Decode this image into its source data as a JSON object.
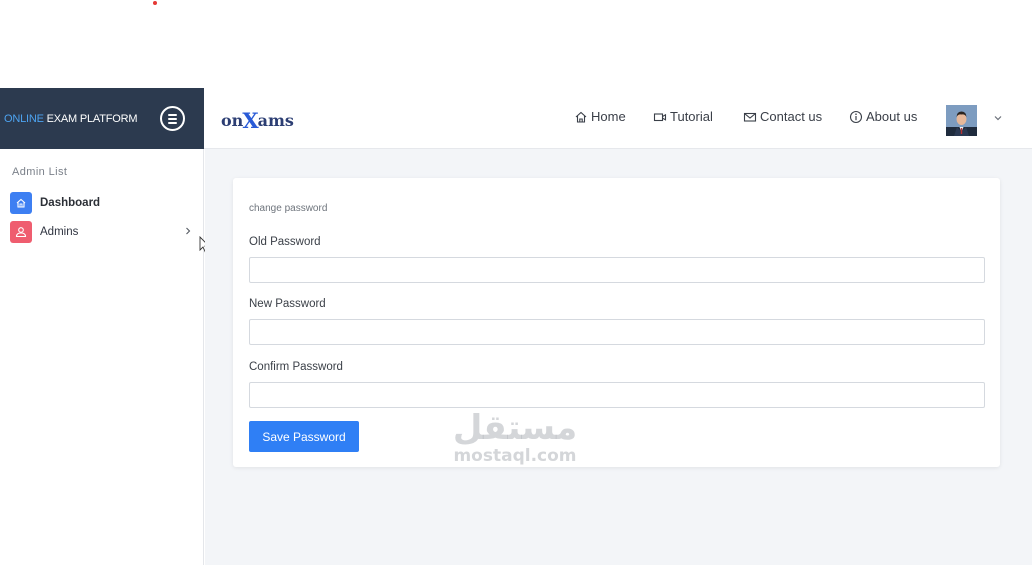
{
  "sidebar_header": {
    "brand_prefix": "ONLINE",
    "brand_rest": " EXAM PLATFORM"
  },
  "navbar": {
    "logo_left": "on",
    "logo_x": "X",
    "logo_right": "ams",
    "links": [
      {
        "label": "Home",
        "icon": "home-icon"
      },
      {
        "label": "Tutorial",
        "icon": "video-icon"
      },
      {
        "label": "Contact us",
        "icon": "envelope-icon"
      },
      {
        "label": "About us",
        "icon": "info-icon"
      }
    ]
  },
  "sidebar": {
    "section_title": "Admin List",
    "items": [
      {
        "label": "Dashboard",
        "icon": "dashboard-icon",
        "color": "#3d7ff2"
      },
      {
        "label": "Admins",
        "icon": "user-icon",
        "color": "#ef5d6f"
      }
    ]
  },
  "form": {
    "title": "change password",
    "fields": [
      {
        "label": "Old Password",
        "value": "",
        "placeholder": ""
      },
      {
        "label": "New Password",
        "value": "",
        "placeholder": ""
      },
      {
        "label": "Confirm Password",
        "value": "",
        "placeholder": ""
      }
    ],
    "submit_label": "Save Password"
  },
  "watermark": {
    "arabic": "مستقل",
    "latin": "mostaql.com"
  },
  "colors": {
    "sidebar_header_bg": "#2c3a4f",
    "accent": "#2f7ff5",
    "brand_highlight": "#4da3f0"
  }
}
